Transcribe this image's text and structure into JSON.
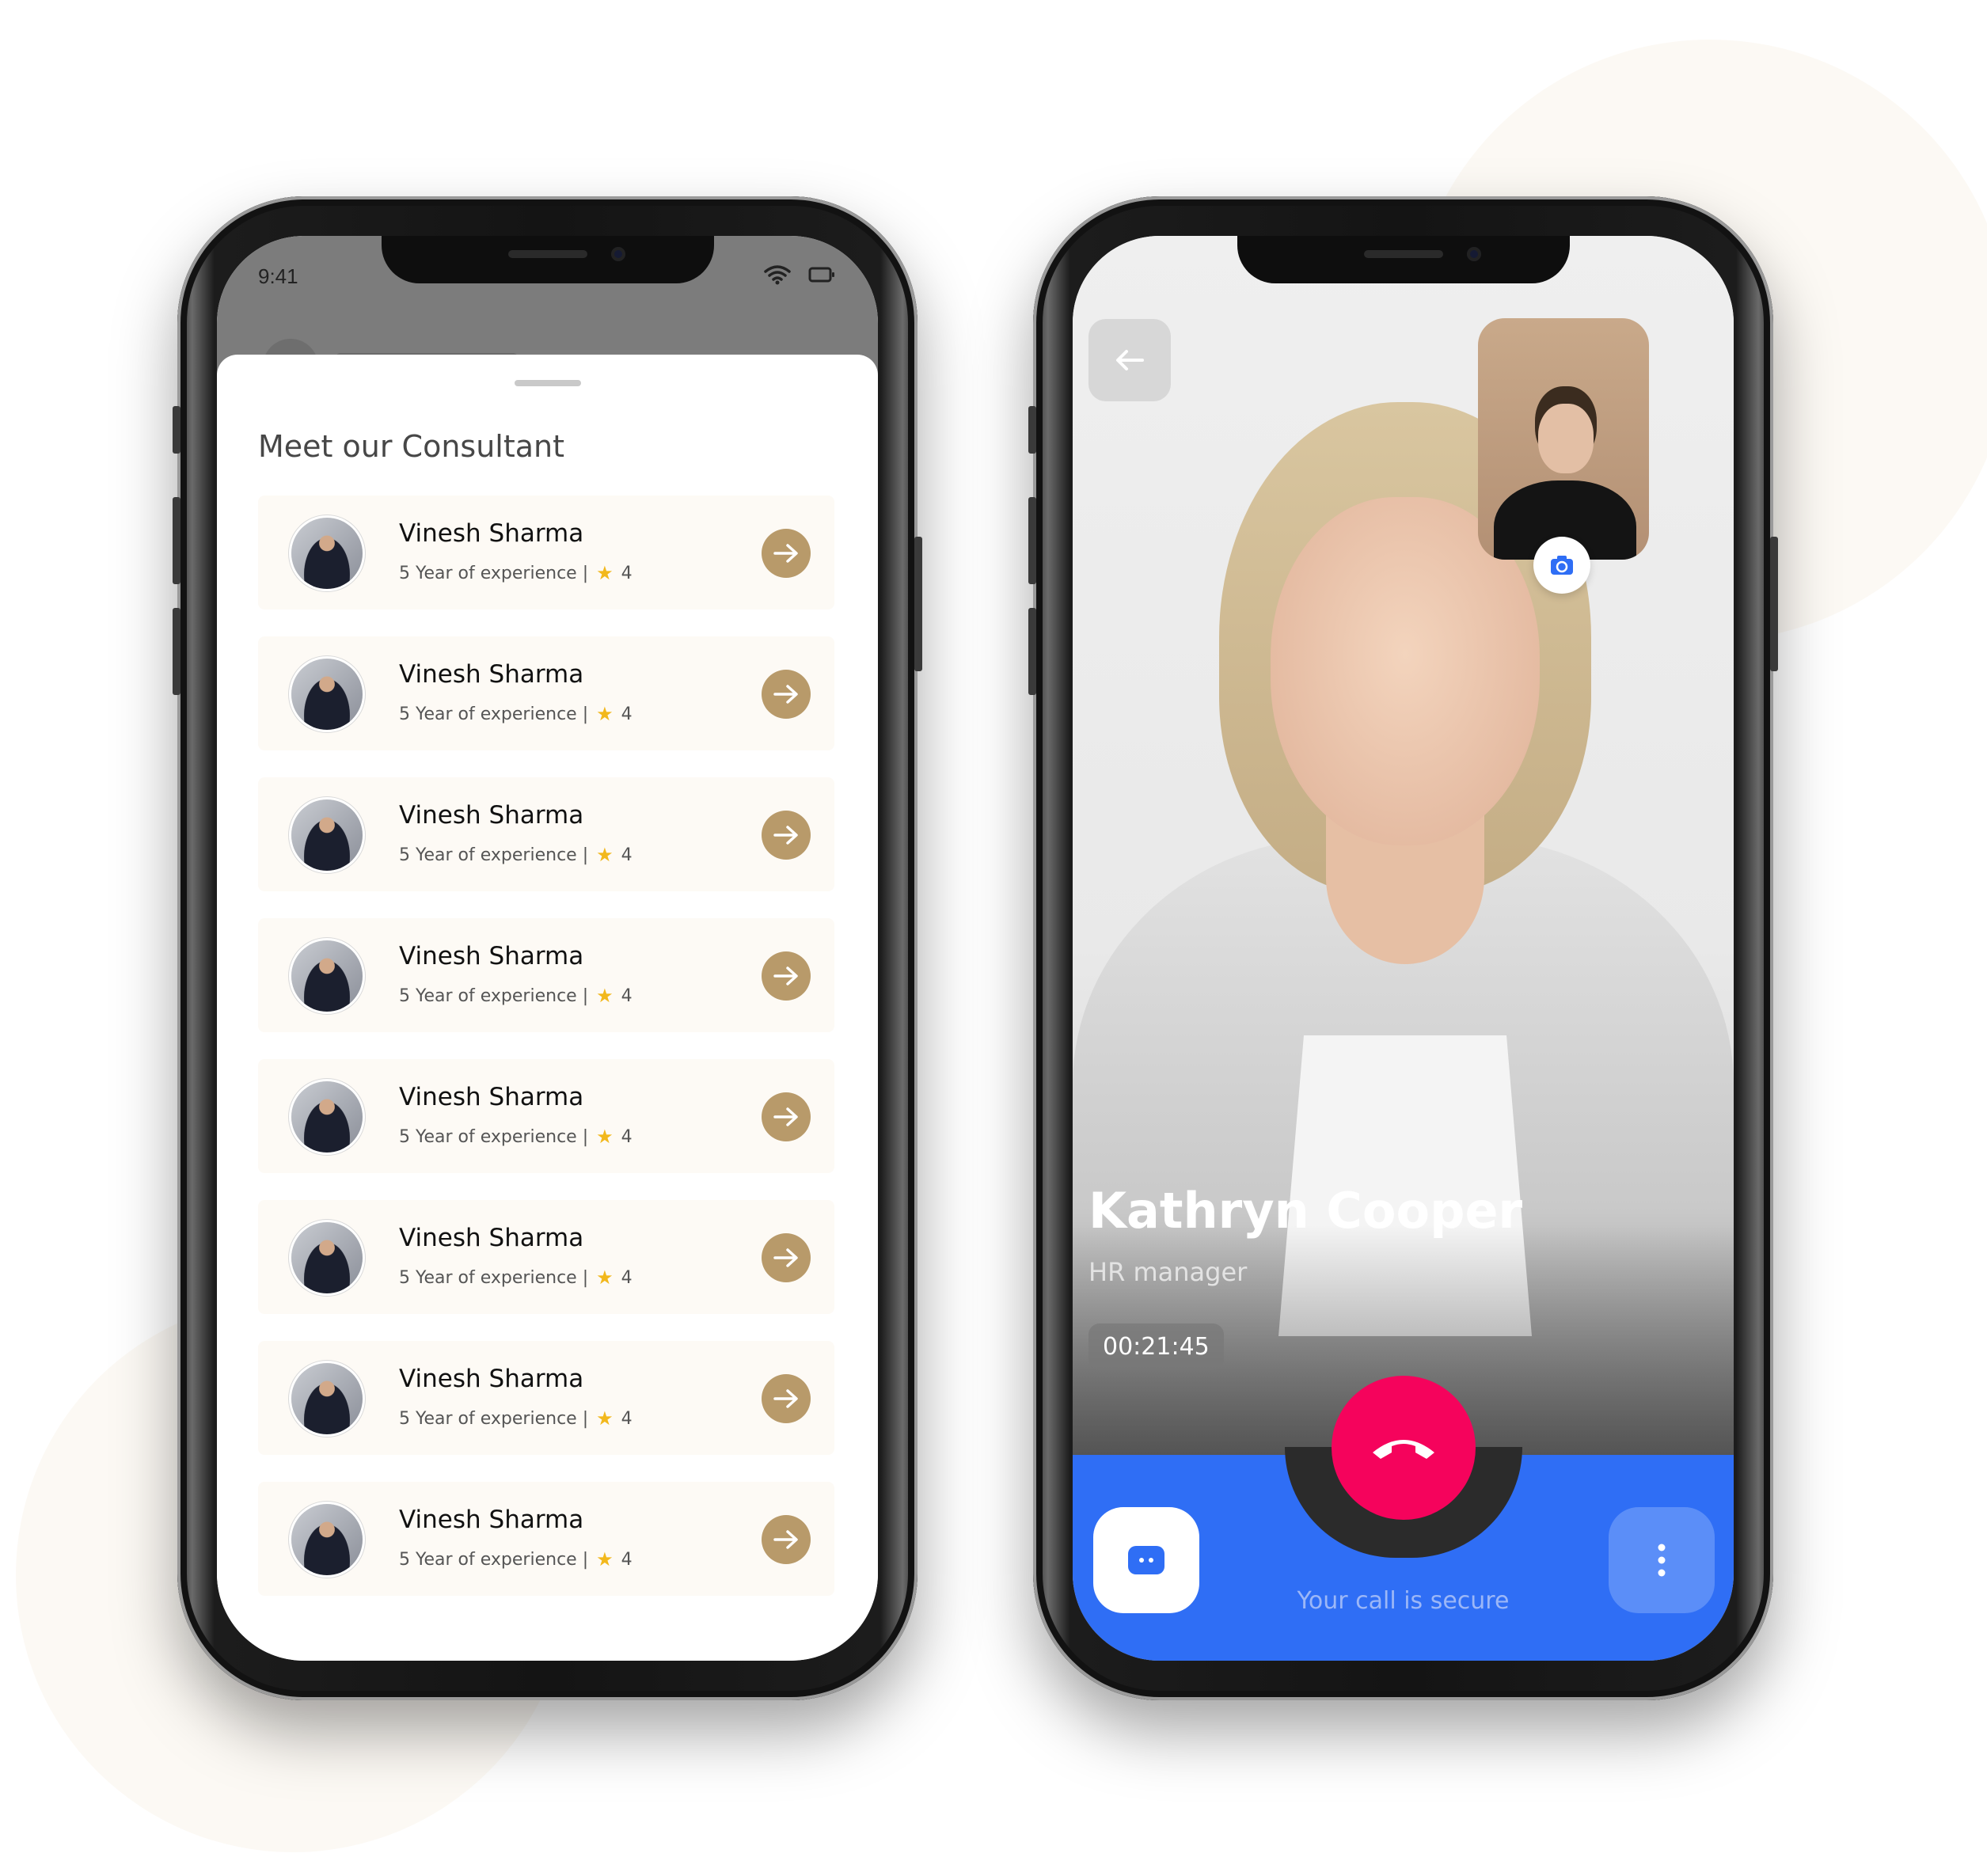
{
  "left_phone": {
    "status_time": "9:41",
    "sheet_title": "Meet our Consultant",
    "consultants": [
      {
        "name": "Vinesh Sharma",
        "experience": "5 Year of experience |",
        "rating": "4"
      },
      {
        "name": "Vinesh Sharma",
        "experience": "5 Year of experience |",
        "rating": "4"
      },
      {
        "name": "Vinesh Sharma",
        "experience": "5 Year of experience |",
        "rating": "4"
      },
      {
        "name": "Vinesh Sharma",
        "experience": "5 Year of experience |",
        "rating": "4"
      },
      {
        "name": "Vinesh Sharma",
        "experience": "5 Year of experience |",
        "rating": "4"
      },
      {
        "name": "Vinesh Sharma",
        "experience": "5 Year of experience |",
        "rating": "4"
      },
      {
        "name": "Vinesh Sharma",
        "experience": "5 Year of experience |",
        "rating": "4"
      },
      {
        "name": "Vinesh Sharma",
        "experience": "5 Year of experience |",
        "rating": "4"
      }
    ],
    "accent_color": "#b89a6a",
    "card_color": "#fdfaf5"
  },
  "right_phone": {
    "caller_name": "Kathryn Cooper",
    "caller_role": "HR manager",
    "call_timer": "00:21:45",
    "secure_text": "Your call is secure",
    "end_call_color": "#f5035c",
    "bar_color": "#2f6ef5"
  },
  "icons": {
    "back": "arrow-left-icon",
    "switch_camera": "camera-switch-icon",
    "end_call": "phone-hangup-icon",
    "chat": "chat-icon",
    "more": "more-vertical-icon",
    "card_action": "arrow-right-icon"
  }
}
